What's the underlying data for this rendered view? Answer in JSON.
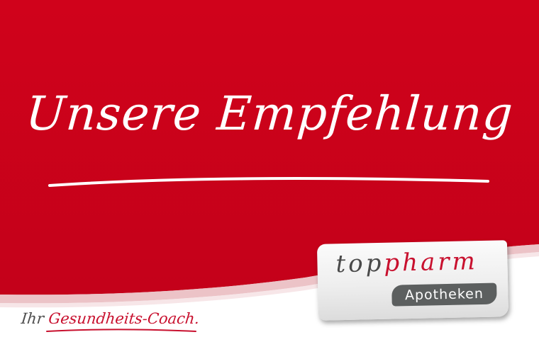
{
  "headline": "Unsere Empfehlung",
  "tagline": {
    "prefix": "Ihr",
    "highlight": "Gesundheits-Coach."
  },
  "logo": {
    "word_top": "top",
    "word_pharm": "pharm",
    "pill_label": "Apotheken"
  },
  "colors": {
    "brand_red": "#d0021b",
    "logo_red": "#c8102e",
    "grey_text": "#4d4d4d",
    "pill_grey": "#5c5f5f",
    "swoosh_pink": "#e9b8bd"
  },
  "icons": [
    "red-wave-background",
    "pink-swoosh"
  ]
}
